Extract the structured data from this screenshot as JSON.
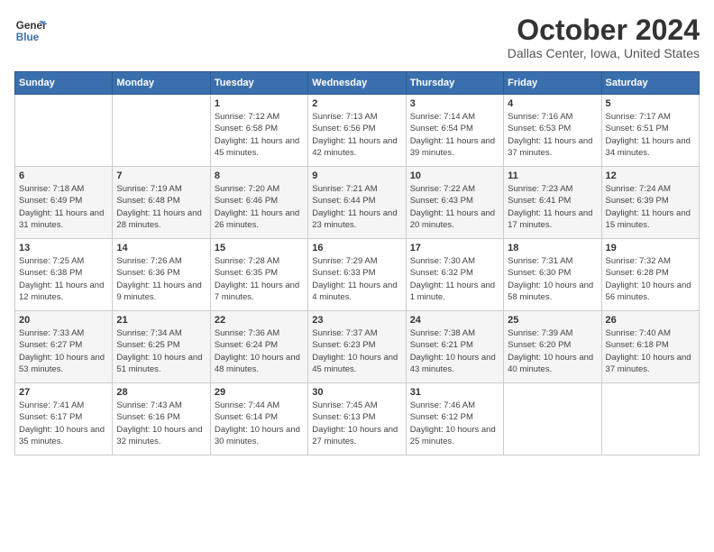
{
  "header": {
    "logo_line1": "General",
    "logo_line2": "Blue",
    "month": "October 2024",
    "location": "Dallas Center, Iowa, United States"
  },
  "days_of_week": [
    "Sunday",
    "Monday",
    "Tuesday",
    "Wednesday",
    "Thursday",
    "Friday",
    "Saturday"
  ],
  "weeks": [
    [
      {
        "day": "",
        "info": ""
      },
      {
        "day": "",
        "info": ""
      },
      {
        "day": "1",
        "info": "Sunrise: 7:12 AM\nSunset: 6:58 PM\nDaylight: 11 hours and 45 minutes."
      },
      {
        "day": "2",
        "info": "Sunrise: 7:13 AM\nSunset: 6:56 PM\nDaylight: 11 hours and 42 minutes."
      },
      {
        "day": "3",
        "info": "Sunrise: 7:14 AM\nSunset: 6:54 PM\nDaylight: 11 hours and 39 minutes."
      },
      {
        "day": "4",
        "info": "Sunrise: 7:16 AM\nSunset: 6:53 PM\nDaylight: 11 hours and 37 minutes."
      },
      {
        "day": "5",
        "info": "Sunrise: 7:17 AM\nSunset: 6:51 PM\nDaylight: 11 hours and 34 minutes."
      }
    ],
    [
      {
        "day": "6",
        "info": "Sunrise: 7:18 AM\nSunset: 6:49 PM\nDaylight: 11 hours and 31 minutes."
      },
      {
        "day": "7",
        "info": "Sunrise: 7:19 AM\nSunset: 6:48 PM\nDaylight: 11 hours and 28 minutes."
      },
      {
        "day": "8",
        "info": "Sunrise: 7:20 AM\nSunset: 6:46 PM\nDaylight: 11 hours and 26 minutes."
      },
      {
        "day": "9",
        "info": "Sunrise: 7:21 AM\nSunset: 6:44 PM\nDaylight: 11 hours and 23 minutes."
      },
      {
        "day": "10",
        "info": "Sunrise: 7:22 AM\nSunset: 6:43 PM\nDaylight: 11 hours and 20 minutes."
      },
      {
        "day": "11",
        "info": "Sunrise: 7:23 AM\nSunset: 6:41 PM\nDaylight: 11 hours and 17 minutes."
      },
      {
        "day": "12",
        "info": "Sunrise: 7:24 AM\nSunset: 6:39 PM\nDaylight: 11 hours and 15 minutes."
      }
    ],
    [
      {
        "day": "13",
        "info": "Sunrise: 7:25 AM\nSunset: 6:38 PM\nDaylight: 11 hours and 12 minutes."
      },
      {
        "day": "14",
        "info": "Sunrise: 7:26 AM\nSunset: 6:36 PM\nDaylight: 11 hours and 9 minutes."
      },
      {
        "day": "15",
        "info": "Sunrise: 7:28 AM\nSunset: 6:35 PM\nDaylight: 11 hours and 7 minutes."
      },
      {
        "day": "16",
        "info": "Sunrise: 7:29 AM\nSunset: 6:33 PM\nDaylight: 11 hours and 4 minutes."
      },
      {
        "day": "17",
        "info": "Sunrise: 7:30 AM\nSunset: 6:32 PM\nDaylight: 11 hours and 1 minute."
      },
      {
        "day": "18",
        "info": "Sunrise: 7:31 AM\nSunset: 6:30 PM\nDaylight: 10 hours and 58 minutes."
      },
      {
        "day": "19",
        "info": "Sunrise: 7:32 AM\nSunset: 6:28 PM\nDaylight: 10 hours and 56 minutes."
      }
    ],
    [
      {
        "day": "20",
        "info": "Sunrise: 7:33 AM\nSunset: 6:27 PM\nDaylight: 10 hours and 53 minutes."
      },
      {
        "day": "21",
        "info": "Sunrise: 7:34 AM\nSunset: 6:25 PM\nDaylight: 10 hours and 51 minutes."
      },
      {
        "day": "22",
        "info": "Sunrise: 7:36 AM\nSunset: 6:24 PM\nDaylight: 10 hours and 48 minutes."
      },
      {
        "day": "23",
        "info": "Sunrise: 7:37 AM\nSunset: 6:23 PM\nDaylight: 10 hours and 45 minutes."
      },
      {
        "day": "24",
        "info": "Sunrise: 7:38 AM\nSunset: 6:21 PM\nDaylight: 10 hours and 43 minutes."
      },
      {
        "day": "25",
        "info": "Sunrise: 7:39 AM\nSunset: 6:20 PM\nDaylight: 10 hours and 40 minutes."
      },
      {
        "day": "26",
        "info": "Sunrise: 7:40 AM\nSunset: 6:18 PM\nDaylight: 10 hours and 37 minutes."
      }
    ],
    [
      {
        "day": "27",
        "info": "Sunrise: 7:41 AM\nSunset: 6:17 PM\nDaylight: 10 hours and 35 minutes."
      },
      {
        "day": "28",
        "info": "Sunrise: 7:43 AM\nSunset: 6:16 PM\nDaylight: 10 hours and 32 minutes."
      },
      {
        "day": "29",
        "info": "Sunrise: 7:44 AM\nSunset: 6:14 PM\nDaylight: 10 hours and 30 minutes."
      },
      {
        "day": "30",
        "info": "Sunrise: 7:45 AM\nSunset: 6:13 PM\nDaylight: 10 hours and 27 minutes."
      },
      {
        "day": "31",
        "info": "Sunrise: 7:46 AM\nSunset: 6:12 PM\nDaylight: 10 hours and 25 minutes."
      },
      {
        "day": "",
        "info": ""
      },
      {
        "day": "",
        "info": ""
      }
    ]
  ]
}
